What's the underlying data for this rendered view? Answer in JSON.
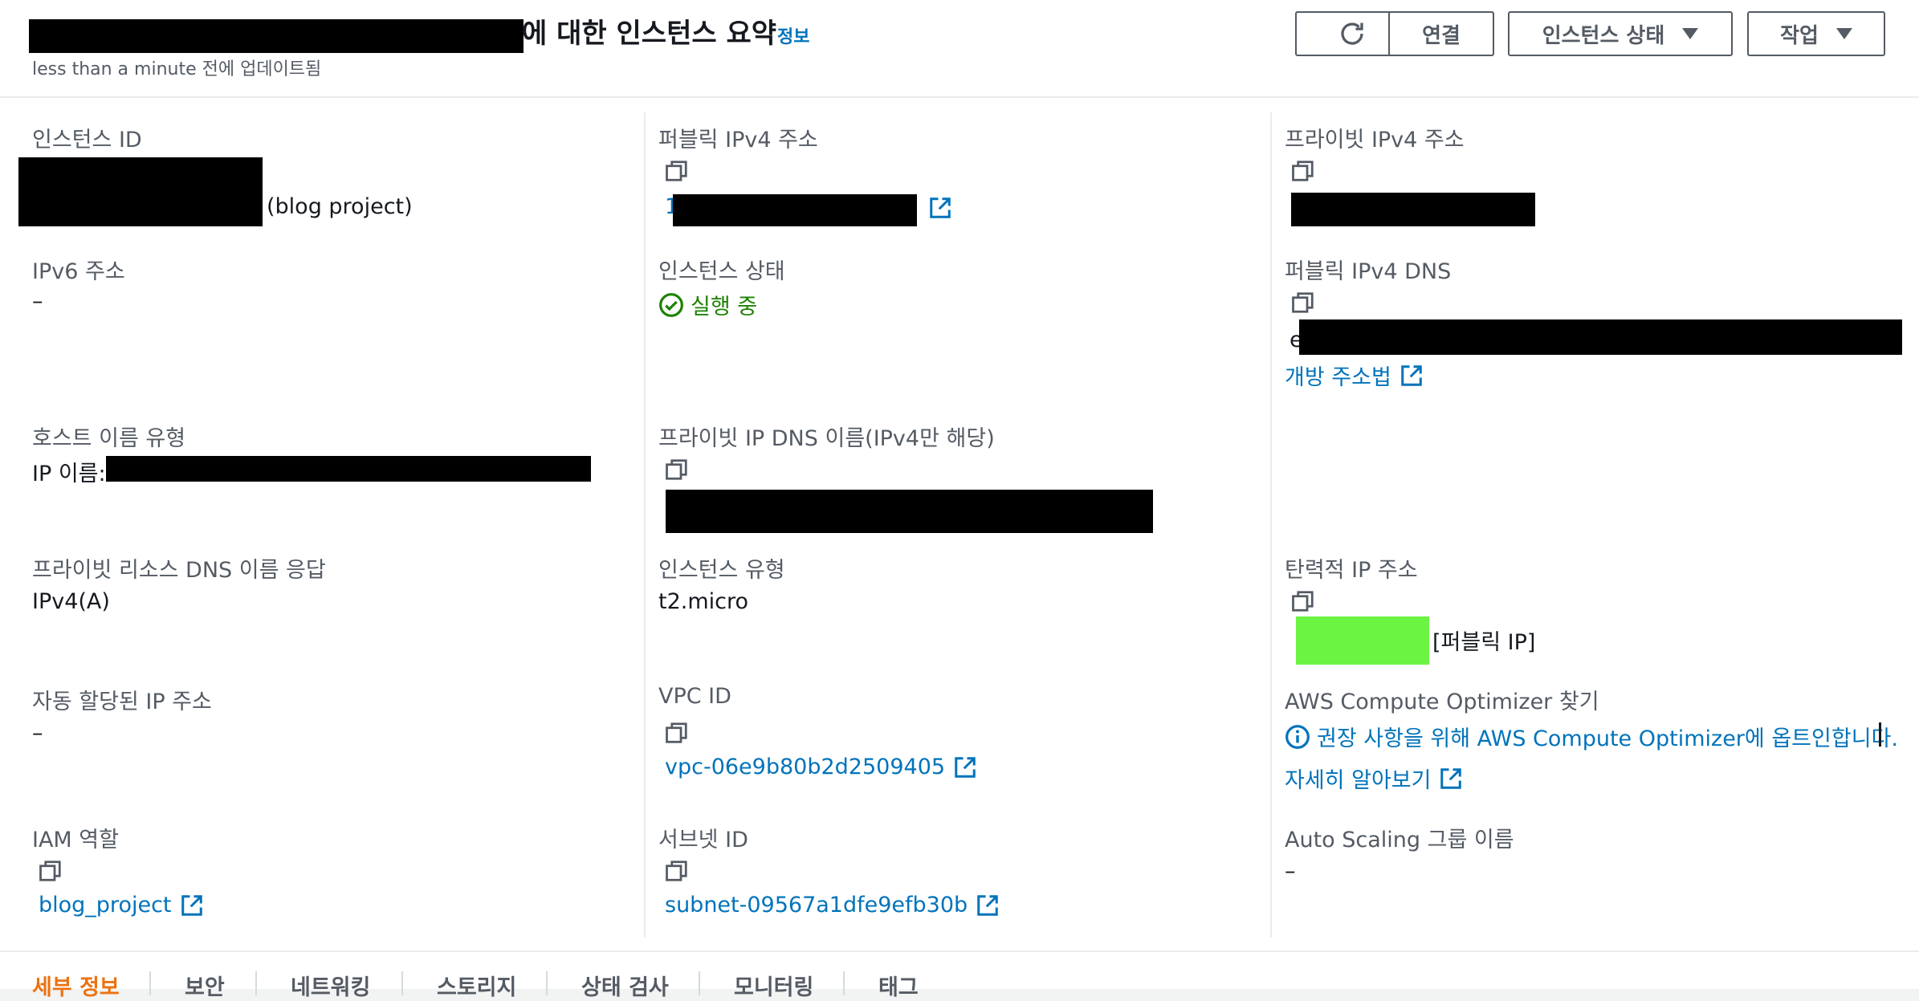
{
  "header": {
    "title_suffix": "에 대한 인스턴스 요약",
    "info_link": "정보",
    "updated": "less than a minute 전에 업데이트됨"
  },
  "toolbar": {
    "connect": "연결",
    "instance_state": "인스턴스 상태",
    "actions": "작업"
  },
  "col1": {
    "instance_id_label": "인스턴스 ID",
    "instance_id_suffix": "(blog project)",
    "ipv6_label": "IPv6 주소",
    "ipv6_value": "–",
    "hostname_type_label": "호스트 이름 유형",
    "hostname_type_prefix": "IP 이름:",
    "private_dns_answer_label": "프라이빗 리소스 DNS 이름 응답",
    "private_dns_answer_value": "IPv4(A)",
    "auto_ip_label": "자동 할당된 IP 주소",
    "auto_ip_value": "–",
    "iam_label": "IAM 역할",
    "iam_value": "blog_project"
  },
  "col2": {
    "public_ipv4_label": "퍼블릭 IPv4 주소",
    "public_ipv4_lead": "1",
    "instance_state_label": "인스턴스 상태",
    "instance_state_value": "실행 중",
    "private_ip_dns_label": "프라이빗 IP DNS 이름(IPv4만 해당)",
    "instance_type_label": "인스턴스 유형",
    "instance_type_value": "t2.micro",
    "vpc_label": "VPC ID",
    "vpc_value": "vpc-06e9b80b2d2509405",
    "subnet_label": "서브넷 ID",
    "subnet_value": "subnet-09567a1dfe9efb30b"
  },
  "col3": {
    "private_ipv4_label": "프라이빗 IPv4 주소",
    "public_dns_label": "퍼블릭 IPv4 DNS",
    "public_dns_lead": "e",
    "open_address": "개방 주소법",
    "elastic_ip_label": "탄력적 IP 주소",
    "elastic_ip_suffix": "[퍼블릭 IP]",
    "optimizer_label": "AWS Compute Optimizer 찾기",
    "optimizer_link": "권장 사항을 위해 AWS Compute Optimizer에 옵트인합니다.",
    "learn_more": "자세히 알아보기",
    "asg_label": "Auto Scaling 그룹 이름",
    "asg_value": "–"
  },
  "tabs": [
    "세부 정보",
    "보안",
    "네트워킹",
    "스토리지",
    "상태 검사",
    "모니터링",
    "태그"
  ],
  "colors": {
    "link": "#0073bb",
    "running": "#1d8102",
    "active_tab": "#ec7211",
    "redaction": "#000000",
    "highlight": "#6cf442"
  },
  "icons": [
    "refresh-icon",
    "caret-down-icon",
    "copy-icon",
    "external-link-icon",
    "check-circle-icon",
    "info-icon"
  ]
}
